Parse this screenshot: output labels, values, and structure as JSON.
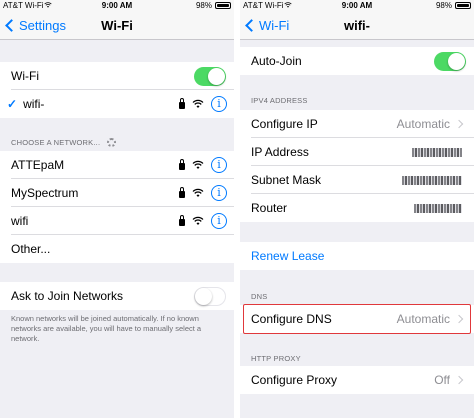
{
  "left": {
    "status": {
      "carrier": "AT&T Wi-Fi",
      "time": "9:00 AM",
      "battery": "98%"
    },
    "nav": {
      "back_label": "Settings",
      "title": "Wi-Fi"
    },
    "wifi_toggle": {
      "label": "Wi-Fi",
      "state": "on"
    },
    "connected": {
      "name": "wifi-",
      "secured": true
    },
    "choose_header": "CHOOSE A NETWORK...",
    "networks": [
      {
        "name": "ATTEpaM",
        "secured": true
      },
      {
        "name": "MySpectrum",
        "secured": true
      },
      {
        "name": "wifi",
        "secured": true
      }
    ],
    "other_label": "Other...",
    "ask_join": {
      "label": "Ask to Join Networks",
      "state": "off"
    },
    "footnote": "Known networks will be joined automatically. If no known networks are available, you will have to manually select a network."
  },
  "right": {
    "status": {
      "carrier": "AT&T Wi-Fi",
      "time": "9:00 AM",
      "battery": "98%"
    },
    "nav": {
      "back_label": "Wi-Fi",
      "title": "wifi-"
    },
    "auto_join": {
      "label": "Auto-Join",
      "state": "on"
    },
    "ipv4_header": "IPV4 ADDRESS",
    "configure_ip": {
      "label": "Configure IP",
      "value": "Automatic"
    },
    "ip_address": {
      "label": "IP Address"
    },
    "subnet_mask": {
      "label": "Subnet Mask"
    },
    "router": {
      "label": "Router"
    },
    "renew_lease": "Renew Lease",
    "dns_header": "DNS",
    "configure_dns": {
      "label": "Configure DNS",
      "value": "Automatic"
    },
    "http_proxy_header": "HTTP PROXY",
    "configure_proxy": {
      "label": "Configure Proxy",
      "value": "Off"
    }
  },
  "colors": {
    "accent": "#007aff",
    "toggle_on": "#4cd964",
    "highlight": "#e0383b",
    "background": "#efeff4"
  }
}
